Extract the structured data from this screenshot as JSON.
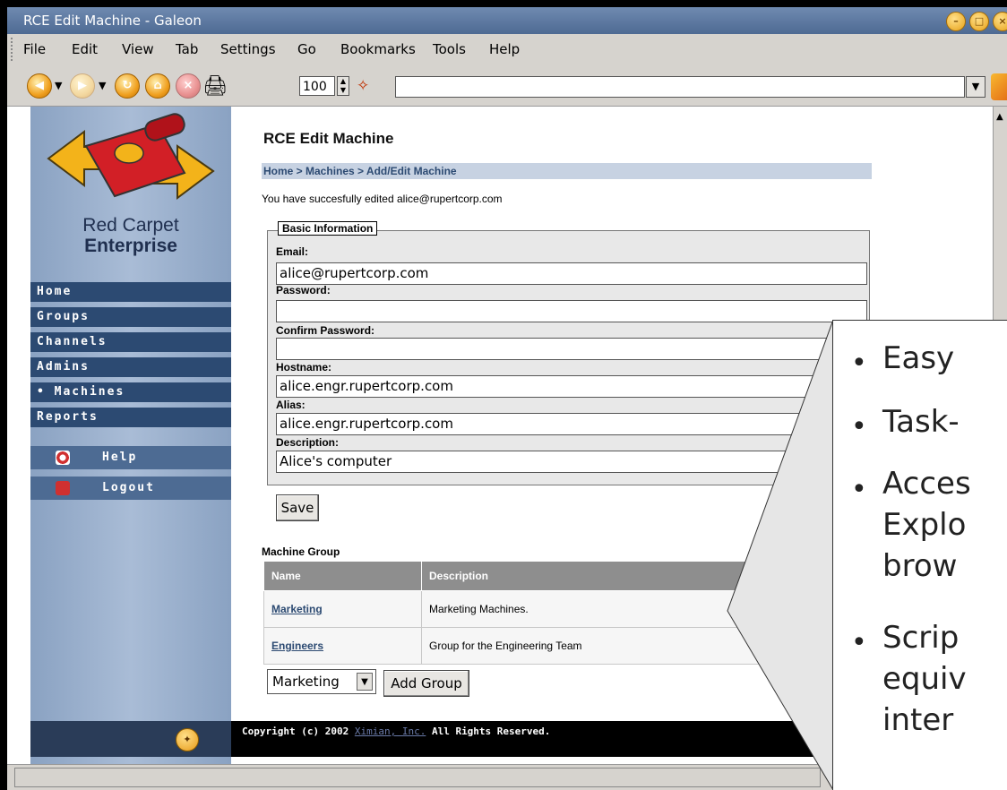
{
  "window": {
    "title": "RCE Edit Machine - Galeon"
  },
  "menu": {
    "items": [
      "File",
      "Edit",
      "View",
      "Tab",
      "Settings",
      "Go",
      "Bookmarks",
      "Tools",
      "Help"
    ]
  },
  "toolbar": {
    "zoom_value": "100",
    "url_value": ""
  },
  "sidebar": {
    "logo_line1": "Red Carpet",
    "logo_line2": "Enterprise",
    "nav": [
      "Home",
      "Groups",
      "Channels",
      "Admins",
      "• Machines",
      "Reports"
    ],
    "help": "Help",
    "logout": "Logout"
  },
  "page": {
    "title": "RCE Edit Machine",
    "breadcrumb": "Home > Machines > Add/Edit Machine",
    "message": "You have succesfully edited alice@rupertcorp.com",
    "section_legend": "Basic Information",
    "fields": {
      "email_label": "Email:",
      "email_value": "alice@rupertcorp.com",
      "password_label": "Password:",
      "password_value": "",
      "confirm_label": "Confirm Password:",
      "confirm_value": "",
      "hostname_label": "Hostname:",
      "hostname_value": "alice.engr.rupertcorp.com",
      "alias_label": "Alias:",
      "alias_value": "alice.engr.rupertcorp.com",
      "description_label": "Description:",
      "description_value": "Alice's computer"
    },
    "save_label": "Save",
    "group_section_title": "Machine Group",
    "group_table": {
      "headers": [
        "Name",
        "Description"
      ],
      "rows": [
        {
          "name": "Marketing",
          "description": "Marketing Machines."
        },
        {
          "name": "Engineers",
          "description": "Group for the Engineering Team"
        }
      ]
    },
    "group_select_value": "Marketing",
    "add_group_label": "Add Group",
    "copyright_prefix": "Copyright (c) 2002 ",
    "copyright_link": "Ximian, Inc.",
    "copyright_suffix": " All Rights Reserved."
  },
  "callout": {
    "bullet_char": "•",
    "lines": [
      "Easy",
      "Task-",
      "Acces",
      "Explo",
      "brow",
      "Scrip",
      "equiv",
      "inter"
    ]
  }
}
